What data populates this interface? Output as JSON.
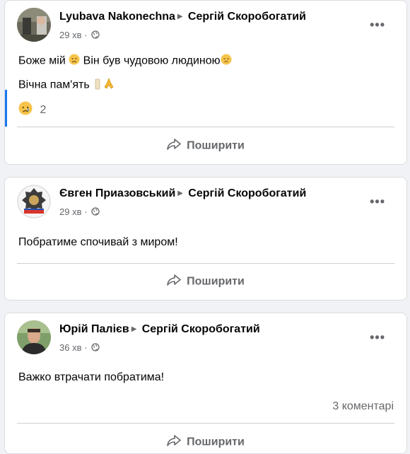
{
  "posts": [
    {
      "author": "Lyubava Nakonechna",
      "target": "Сергій Скоробогатий",
      "time": "29 хв",
      "lines": [
        "Боже мій",
        "Він був чудовою людиною",
        "Вічна пам'ять"
      ],
      "reaction_count": "2",
      "share_label": "Поширити"
    },
    {
      "author": "Євген Приазовський",
      "target": "Сергій Скоробогатий",
      "time": "29 хв",
      "text": "Побратиме спочивай з миром!",
      "share_label": "Поширити"
    },
    {
      "author": "Юрій Палієв",
      "target": "Сергій Скоробогатий",
      "time": "36 хв",
      "text": "Важко втрачати побратима!",
      "comments": "3 коментарі",
      "share_label": "Поширити"
    }
  ],
  "icons": {
    "more": "more-horizontal-icon",
    "globe": "globe-icon",
    "share": "share-arrow-icon",
    "separator": "triangle-right-icon",
    "sad_emoji": "sad-face-icon",
    "candle": "candle-icon",
    "pray": "praying-hands-icon"
  }
}
